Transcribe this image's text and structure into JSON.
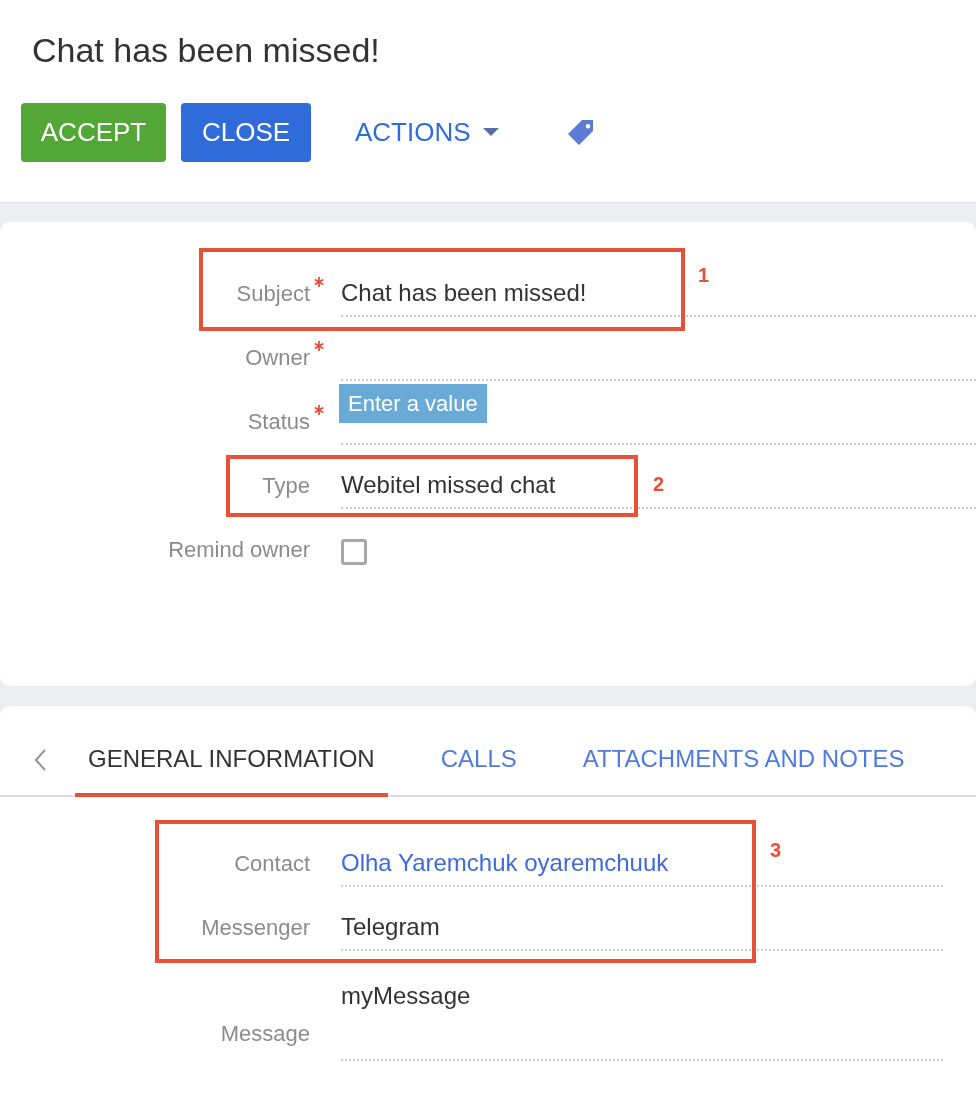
{
  "page": {
    "title": "Chat has been missed!"
  },
  "toolbar": {
    "buttons": [
      {
        "label": "ACCEPT",
        "kind": "success"
      },
      {
        "label": "CLOSE",
        "kind": "primary"
      },
      {
        "label": "ACTIONS",
        "kind": "menu"
      },
      {
        "kind": "tag"
      }
    ]
  },
  "main_fields": [
    {
      "label": "Subject",
      "required": true,
      "kind": "text",
      "value": "Chat has been missed!"
    },
    {
      "label": "Owner",
      "required": true,
      "kind": "text"
    },
    {
      "label": "Status",
      "required": true,
      "kind": "text",
      "tooltip": "Enter a value"
    },
    {
      "label": "Type",
      "required": false,
      "kind": "text",
      "value": "Webitel missed chat"
    },
    {
      "label": "Remind owner",
      "required": false,
      "kind": "checkbox",
      "checked": false
    }
  ],
  "tabs": [
    {
      "label": "GENERAL INFORMATION",
      "selected": true
    },
    {
      "label": "CALLS",
      "selected": false
    },
    {
      "label": "ATTACHMENTS AND NOTES",
      "selected": false
    }
  ],
  "detail_fields": [
    {
      "label": "Contact",
      "kind": "link",
      "value": "Olha Yaremchuk oyaremchuuk"
    },
    {
      "label": "Messenger",
      "kind": "text",
      "value": "Telegram"
    },
    {
      "label": "Message",
      "kind": "memo",
      "value": "myMessage"
    }
  ],
  "annotations": [
    {
      "label": "1"
    },
    {
      "label": "2"
    },
    {
      "label": "3"
    }
  ]
}
